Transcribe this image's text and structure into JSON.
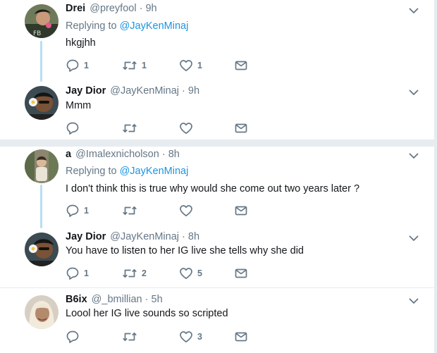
{
  "replies": [
    {
      "name": "Drei",
      "handle": "@preyfool",
      "time": " · 9h",
      "replying_prefix": "Replying to ",
      "replying_to": "@JayKenMinaj",
      "text": "hkgjhh",
      "counts": {
        "reply": "1",
        "retweet": "1",
        "like": "1"
      }
    },
    {
      "name": "Jay Dior",
      "handle": "@JayKenMinaj",
      "time": " · 9h",
      "replying_prefix": "",
      "replying_to": "",
      "text": "Mmm",
      "counts": {
        "reply": "",
        "retweet": "",
        "like": ""
      }
    },
    {
      "name": "a",
      "handle": "@Imalexnicholson",
      "time": " · 8h",
      "replying_prefix": "Replying to ",
      "replying_to": "@JayKenMinaj",
      "text": "I don't think this is true why would she come out two years later ?",
      "counts": {
        "reply": "1",
        "retweet": "",
        "like": ""
      }
    },
    {
      "name": "Jay Dior",
      "handle": "@JayKenMinaj",
      "time": " · 8h",
      "replying_prefix": "",
      "replying_to": "",
      "text": "You have to listen to her IG live she tells why she did",
      "counts": {
        "reply": "1",
        "retweet": "2",
        "like": "5"
      }
    },
    {
      "name": "B6ix",
      "handle": "@_bmillian",
      "time": " · 5h",
      "replying_prefix": "",
      "replying_to": "",
      "text": "Loool her IG live sounds so scripted",
      "counts": {
        "reply": "",
        "retweet": "",
        "like": "3"
      }
    }
  ],
  "colors": {
    "link": "#1b95e0",
    "muted": "#657786",
    "thread": "#b8def5",
    "divider": "#e6ecf0"
  },
  "icons": [
    "chevron-down-icon",
    "reply-icon",
    "retweet-icon",
    "like-icon",
    "message-icon"
  ]
}
